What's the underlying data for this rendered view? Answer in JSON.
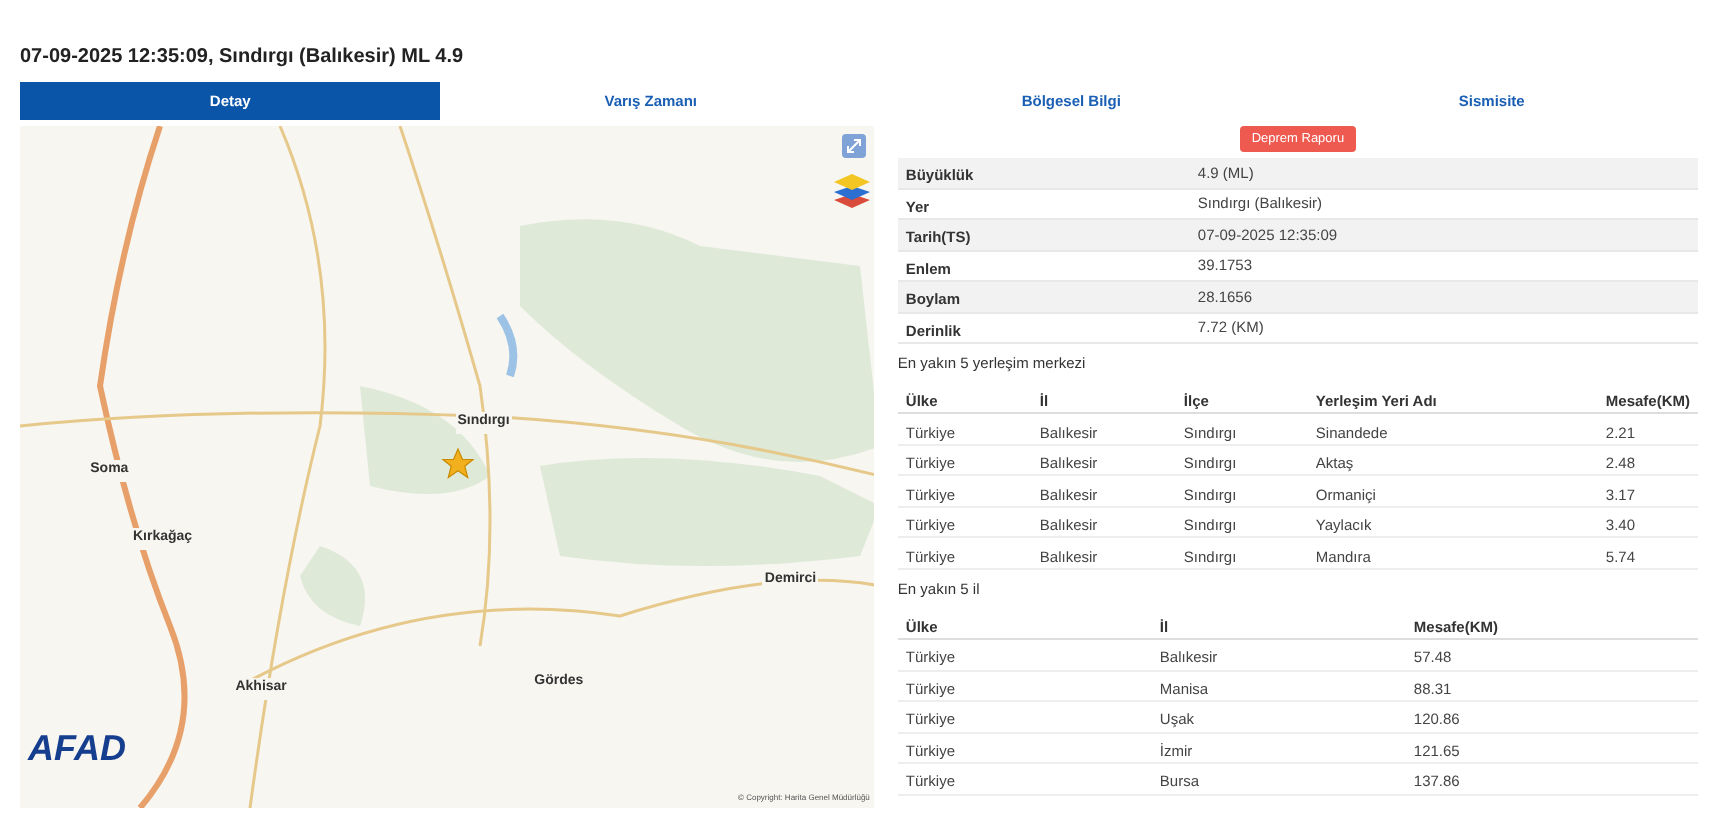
{
  "title": "07-09-2025 12:35:09, Sındırgı (Balıkesir) ML 4.9",
  "tabs": [
    {
      "label": "Detay",
      "selected": true
    },
    {
      "label": "Varış Zamanı",
      "selected": false
    },
    {
      "label": "Bölgesel Bilgi",
      "selected": false
    },
    {
      "label": "Sismisite",
      "selected": false
    }
  ],
  "map": {
    "places": [
      "Sındırgı",
      "Soma",
      "Kırkağaç",
      "Akhisar",
      "Gördes",
      "Demirci"
    ],
    "logo": "AFAD",
    "attribution": "© Copyright: Harita Genel Müdürlüğü"
  },
  "report_button": "Deprem Raporu",
  "details": [
    {
      "label": "Büyüklük",
      "value": "4.9 (ML)"
    },
    {
      "label": "Yer",
      "value": "Sındırgı (Balıkesir)"
    },
    {
      "label": "Tarih(TS)",
      "value": "07-09-2025 12:35:09"
    },
    {
      "label": "Enlem",
      "value": "39.1753"
    },
    {
      "label": "Boylam",
      "value": "28.1656"
    },
    {
      "label": "Derinlik",
      "value": "7.72 (KM)"
    }
  ],
  "settlements": {
    "heading": "En yakın 5 yerleşim merkezi",
    "columns": [
      "Ülke",
      "İl",
      "İlçe",
      "Yerleşim Yeri Adı",
      "Mesafe(KM)"
    ],
    "rows": [
      [
        "Türkiye",
        "Balıkesir",
        "Sındırgı",
        "Sinandede",
        "2.21"
      ],
      [
        "Türkiye",
        "Balıkesir",
        "Sındırgı",
        "Aktaş",
        "2.48"
      ],
      [
        "Türkiye",
        "Balıkesir",
        "Sındırgı",
        "Ormaniçi",
        "3.17"
      ],
      [
        "Türkiye",
        "Balıkesir",
        "Sındırgı",
        "Yaylacık",
        "3.40"
      ],
      [
        "Türkiye",
        "Balıkesir",
        "Sındırgı",
        "Mandıra",
        "5.74"
      ]
    ]
  },
  "provinces": {
    "heading": "En yakın 5 il",
    "columns": [
      "Ülke",
      "İl",
      "Mesafe(KM)"
    ],
    "rows": [
      [
        "Türkiye",
        "Balıkesir",
        "57.48"
      ],
      [
        "Türkiye",
        "Manisa",
        "88.31"
      ],
      [
        "Türkiye",
        "Uşak",
        "120.86"
      ],
      [
        "Türkiye",
        "İzmir",
        "121.65"
      ],
      [
        "Türkiye",
        "Bursa",
        "137.86"
      ]
    ]
  }
}
